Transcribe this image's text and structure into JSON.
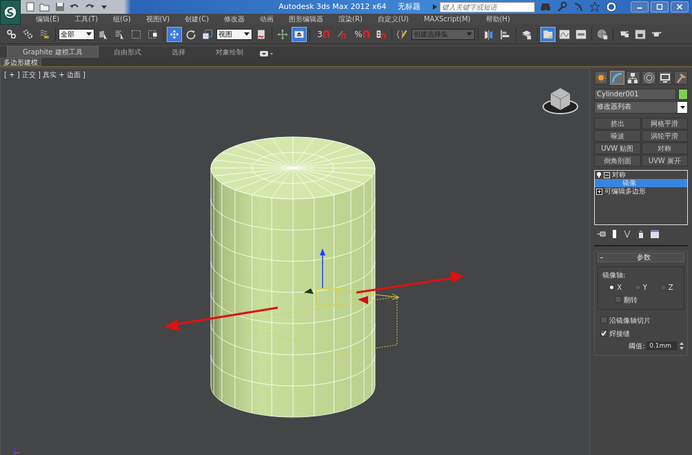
{
  "title_bar": {
    "title": "Autodesk 3ds Max  2012 x64",
    "document": "无标题",
    "search": {
      "placeholder": "键入关键字或短语"
    }
  },
  "menu": [
    "编辑(E)",
    "工具(T)",
    "组(G)",
    "视图(V)",
    "创建(C)",
    "修改器",
    "动画",
    "图形编辑器",
    "渲染(R)",
    "自定义(U)",
    "MAXScript(M)",
    "帮助(H)"
  ],
  "toolbar": [
    {
      "kind": "link",
      "selected": false
    },
    {
      "kind": "unlink",
      "selected": false
    },
    {
      "kind": "bind",
      "selected": false
    },
    {
      "kind": "separator"
    },
    {
      "kind": "dropdown",
      "value": "全部"
    },
    {
      "kind": "select",
      "selected": false
    },
    {
      "kind": "select-by-name",
      "selected": false
    },
    {
      "kind": "region",
      "selected": false
    },
    {
      "kind": "crossing",
      "selected": false
    },
    {
      "kind": "separator"
    },
    {
      "kind": "move",
      "selected": true
    },
    {
      "kind": "rotate",
      "selected": false
    },
    {
      "kind": "scale",
      "selected": false
    },
    {
      "kind": "dropdown",
      "value": "视图"
    },
    {
      "kind": "pivot",
      "selected": false
    },
    {
      "kind": "separator"
    },
    {
      "kind": "manipulate",
      "selected": false
    },
    {
      "kind": "shortcut",
      "selected": true
    },
    {
      "kind": "separator"
    },
    {
      "kind": "snap",
      "label": "3",
      "selected": false
    },
    {
      "kind": "angle-snap",
      "selected": false
    },
    {
      "kind": "percent-snap",
      "label": "%",
      "selected": false
    },
    {
      "kind": "spinner-snap",
      "selected": false
    },
    {
      "kind": "separator"
    },
    {
      "kind": "named-selection",
      "selected": false
    },
    {
      "kind": "dropdown",
      "value": "创建选择集"
    },
    {
      "kind": "separator"
    },
    {
      "kind": "mirror",
      "selected": false
    },
    {
      "kind": "align",
      "selected": false
    },
    {
      "kind": "separator"
    },
    {
      "kind": "layers",
      "selected": false
    },
    {
      "kind": "separator"
    },
    {
      "kind": "ribbon",
      "selected": true
    },
    {
      "kind": "curve",
      "selected": false
    },
    {
      "kind": "schematic",
      "selected": false
    },
    {
      "kind": "separator"
    },
    {
      "kind": "material",
      "selected": false
    },
    {
      "kind": "separator"
    },
    {
      "kind": "render-setup",
      "selected": false
    },
    {
      "kind": "frame",
      "selected": false
    },
    {
      "kind": "render",
      "selected": false
    }
  ],
  "ribbon": {
    "tabs": [
      {
        "label": "Graphite 建模工具",
        "selected": true
      },
      {
        "label": "自由形式",
        "selected": false
      },
      {
        "label": "选择",
        "selected": false
      },
      {
        "label": "对象绘制",
        "selected": false
      }
    ],
    "panel": "多边形建模"
  },
  "viewport": {
    "label": "[ + ] 正交 ] 真实 + 边面 ]"
  },
  "command_panel": {
    "tabs": [
      {
        "kind": "create",
        "selected": false
      },
      {
        "kind": "modify",
        "selected": true
      },
      {
        "kind": "hierarchy",
        "selected": false
      },
      {
        "kind": "motion",
        "selected": false
      },
      {
        "kind": "display",
        "selected": false
      },
      {
        "kind": "utilities",
        "selected": false
      }
    ],
    "object": {
      "name": "Cylinder001",
      "color": "#80d050"
    },
    "modifier_list": "修改器列表",
    "modifier_buttons": [
      "挤出",
      "网格平滑",
      "噪波",
      "涡轮平滑",
      "UVW 贴图",
      "对称",
      "倒角剖面",
      "UVW 展开"
    ],
    "stack": [
      {
        "label": "对称",
        "expanded": true,
        "selected": false,
        "children": [
          {
            "label": "镜像",
            "selected": true
          }
        ]
      },
      {
        "label": "可编辑多边形",
        "expanded": false,
        "selected": false
      }
    ],
    "parameters": {
      "title": "参数",
      "mirror_axis": {
        "label": "镜像轴:",
        "axes": [
          {
            "label": "X",
            "selected": true
          },
          {
            "label": "Y",
            "selected": false
          },
          {
            "label": "Z",
            "selected": false
          }
        ],
        "flip": {
          "label": "翻转",
          "checked": false
        }
      },
      "slice": {
        "label": "沿镜像轴切片",
        "checked": false
      },
      "weld": {
        "label": "焊接缝",
        "checked": true
      },
      "threshold": {
        "label": "阈值:",
        "value": "0.1mm"
      }
    }
  }
}
